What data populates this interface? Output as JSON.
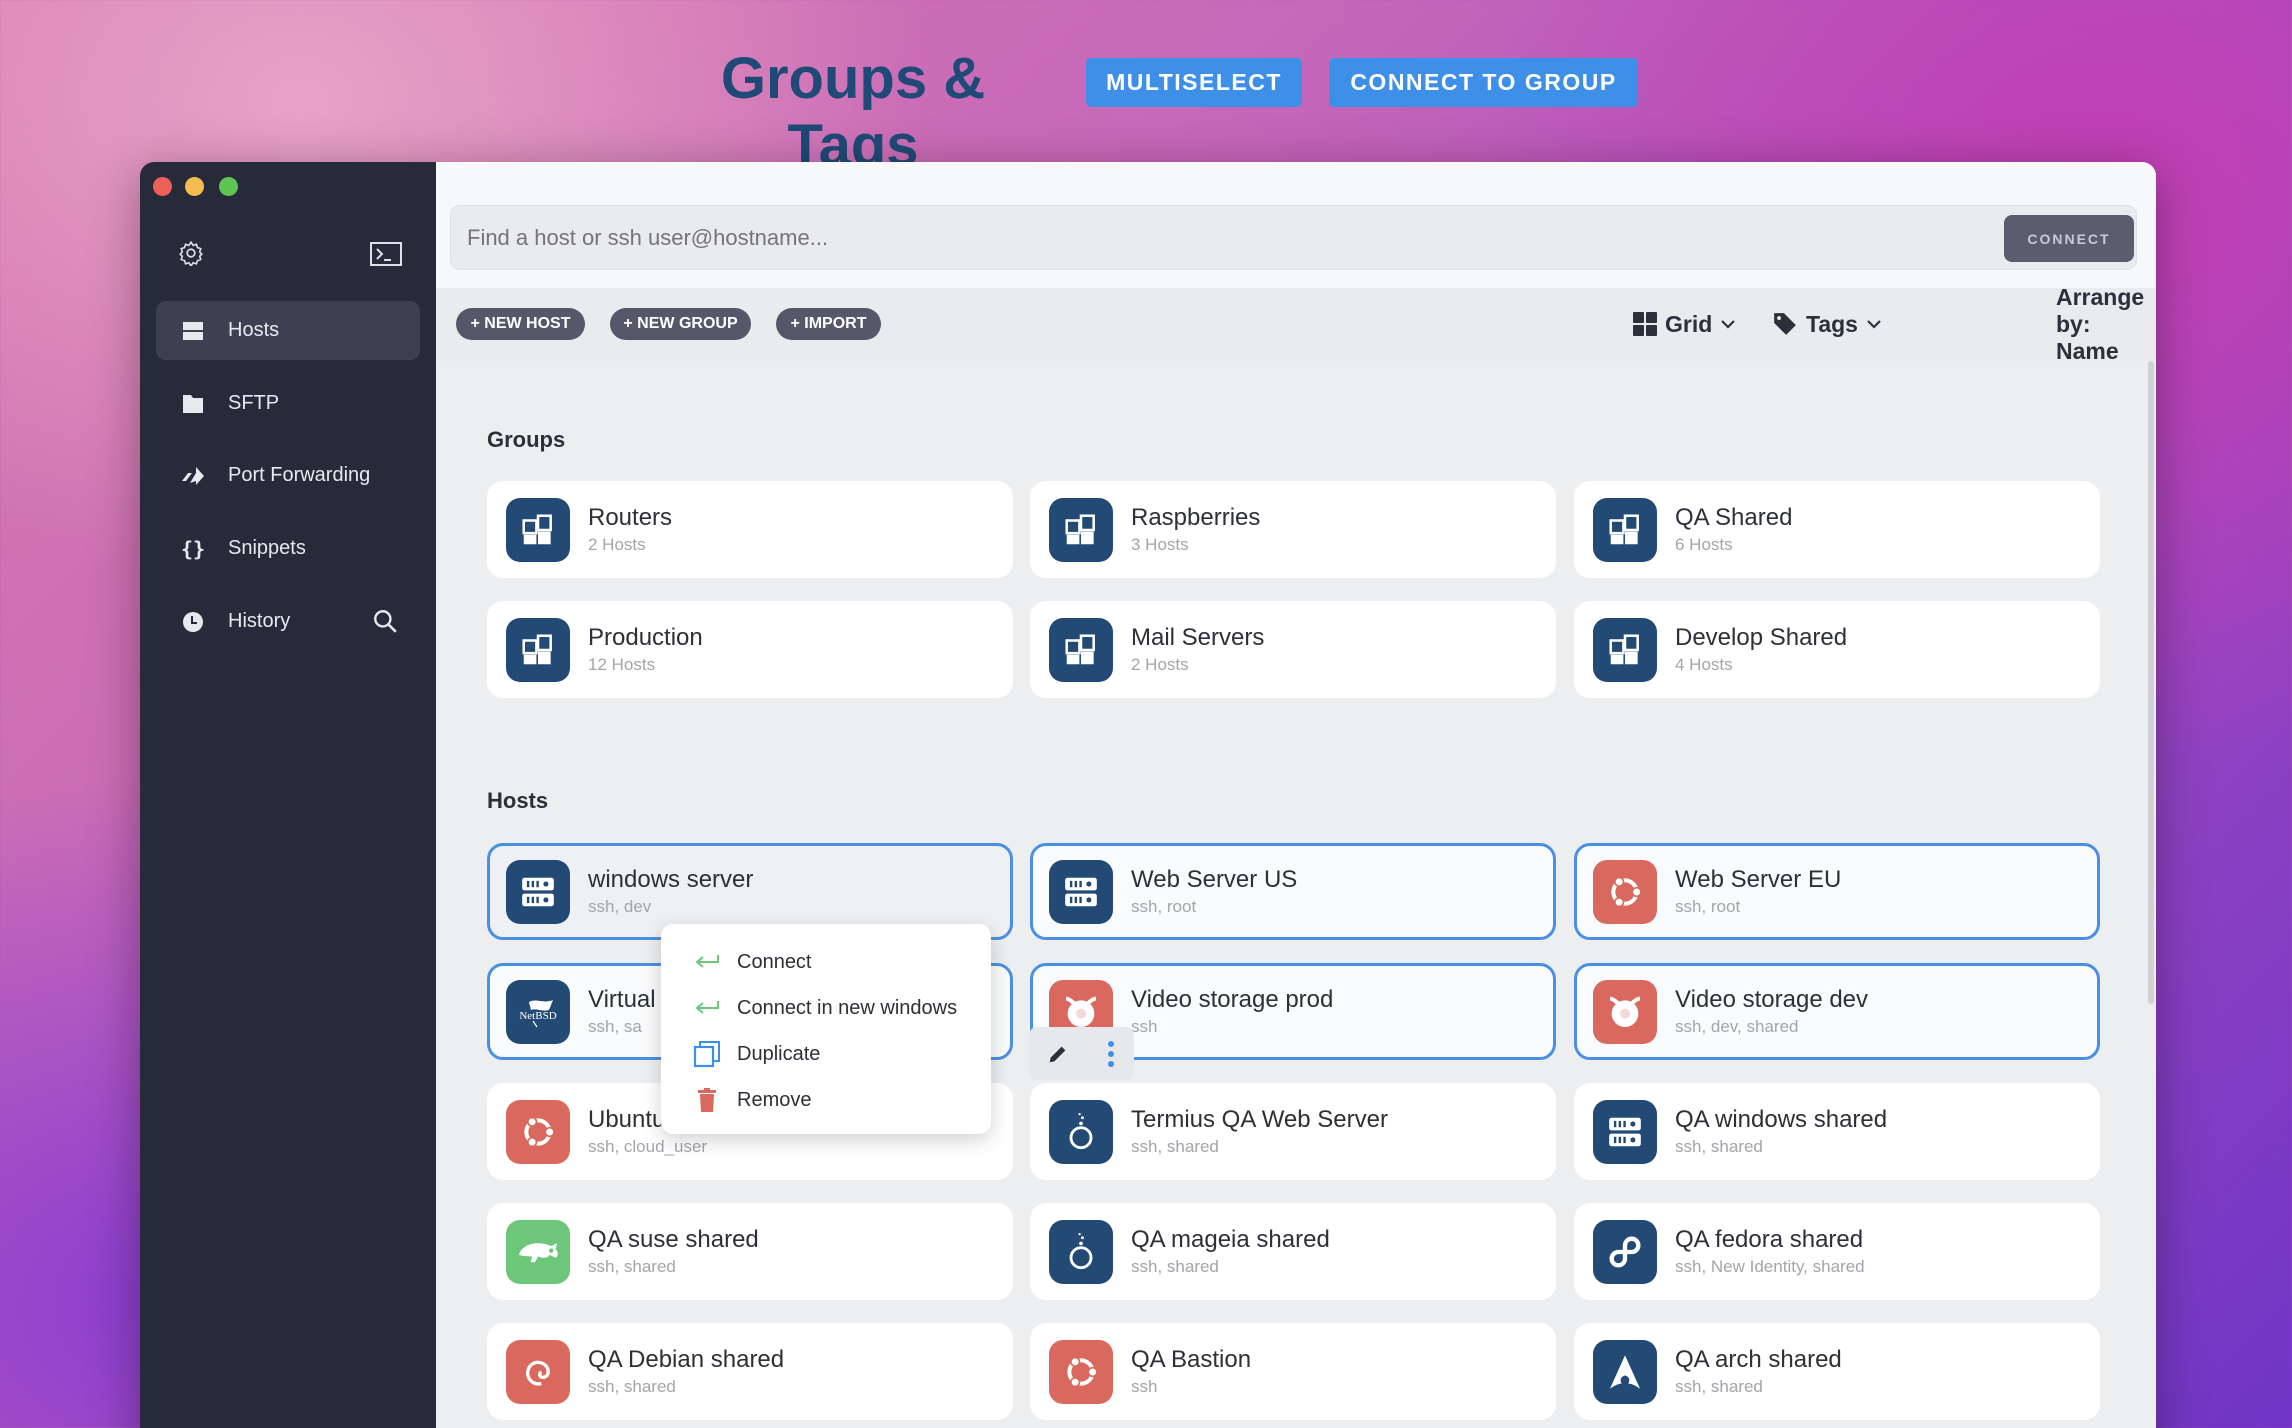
{
  "header": {
    "title": "Groups & Tags",
    "multiselect": "MULTISELECT",
    "connect_group": "CONNECT TO GROUP"
  },
  "colors": {
    "accent": "#3d8fe8",
    "navy": "#234a75",
    "red": "#d9685f",
    "green": "#6cc77a",
    "sidebar": "#272a38"
  },
  "sidebar": {
    "items": [
      {
        "label": "Hosts",
        "icon": "server-icon",
        "selected": true
      },
      {
        "label": "SFTP",
        "icon": "folder-icon"
      },
      {
        "label": "Port Forwarding",
        "icon": "port-forward-icon"
      },
      {
        "label": "Snippets",
        "icon": "braces-icon"
      },
      {
        "label": "History",
        "icon": "clock-icon"
      }
    ]
  },
  "search": {
    "placeholder": "Find a host or ssh user@hostname...",
    "connect": "CONNECT"
  },
  "toolbar": {
    "new_host": "+ NEW HOST",
    "new_group": "+ NEW GROUP",
    "import": "+ IMPORT",
    "view": "Grid",
    "tags": "Tags",
    "arrange": "Arrange by: Name"
  },
  "groups_label": "Groups",
  "hosts_label": "Hosts",
  "groups": [
    {
      "name": "Routers",
      "sub": "2 Hosts"
    },
    {
      "name": "Raspberries",
      "sub": "3 Hosts"
    },
    {
      "name": "QA Shared",
      "sub": "6 Hosts"
    },
    {
      "name": "Production",
      "sub": "12 Hosts"
    },
    {
      "name": "Mail Servers",
      "sub": "2 Hosts"
    },
    {
      "name": "Develop Shared",
      "sub": "4 Hosts"
    }
  ],
  "hosts": [
    {
      "name": "windows server",
      "sub": "ssh, dev",
      "icon": "server",
      "color": "navy",
      "selected": true
    },
    {
      "name": "Web Server US",
      "sub": "ssh, root",
      "icon": "server",
      "color": "navy",
      "selected": true
    },
    {
      "name": "Web Server EU",
      "sub": "ssh, root",
      "icon": "ubuntu",
      "color": "red",
      "selected": true
    },
    {
      "name": "Virtual",
      "sub": "ssh, sa",
      "icon": "netbsd",
      "color": "navy",
      "selected": true
    },
    {
      "name": "Video storage prod",
      "sub": "ssh",
      "icon": "freebsd",
      "color": "red",
      "selected": true
    },
    {
      "name": "Video storage dev",
      "sub": "ssh, dev, shared",
      "icon": "freebsd",
      "color": "red",
      "selected": true
    },
    {
      "name": "Ubuntu",
      "sub": "ssh, cloud_user",
      "icon": "ubuntu",
      "color": "red"
    },
    {
      "name": "Termius QA Web Server",
      "sub": "ssh, shared",
      "icon": "mageia",
      "color": "navy"
    },
    {
      "name": "QA windows shared",
      "sub": "ssh, shared",
      "icon": "server",
      "color": "navy"
    },
    {
      "name": "QA suse shared",
      "sub": "ssh, shared",
      "icon": "suse",
      "color": "green"
    },
    {
      "name": "QA mageia shared",
      "sub": "ssh, shared",
      "icon": "mageia",
      "color": "navy"
    },
    {
      "name": "QA fedora shared",
      "sub": "ssh, New Identity, shared",
      "icon": "fedora",
      "color": "navy"
    },
    {
      "name": "QA Debian shared",
      "sub": "ssh, shared",
      "icon": "debian",
      "color": "red"
    },
    {
      "name": "QA Bastion",
      "sub": "ssh",
      "icon": "ubuntu",
      "color": "red"
    },
    {
      "name": "QA arch shared",
      "sub": "ssh, shared",
      "icon": "arch",
      "color": "navy"
    }
  ],
  "context_menu": {
    "items": [
      {
        "label": "Connect",
        "icon": "connect-arrow-icon"
      },
      {
        "label": "Connect in new windows",
        "icon": "connect-arrow-icon"
      },
      {
        "label": "Duplicate",
        "icon": "duplicate-icon"
      },
      {
        "label": "Remove",
        "icon": "trash-icon"
      }
    ]
  }
}
